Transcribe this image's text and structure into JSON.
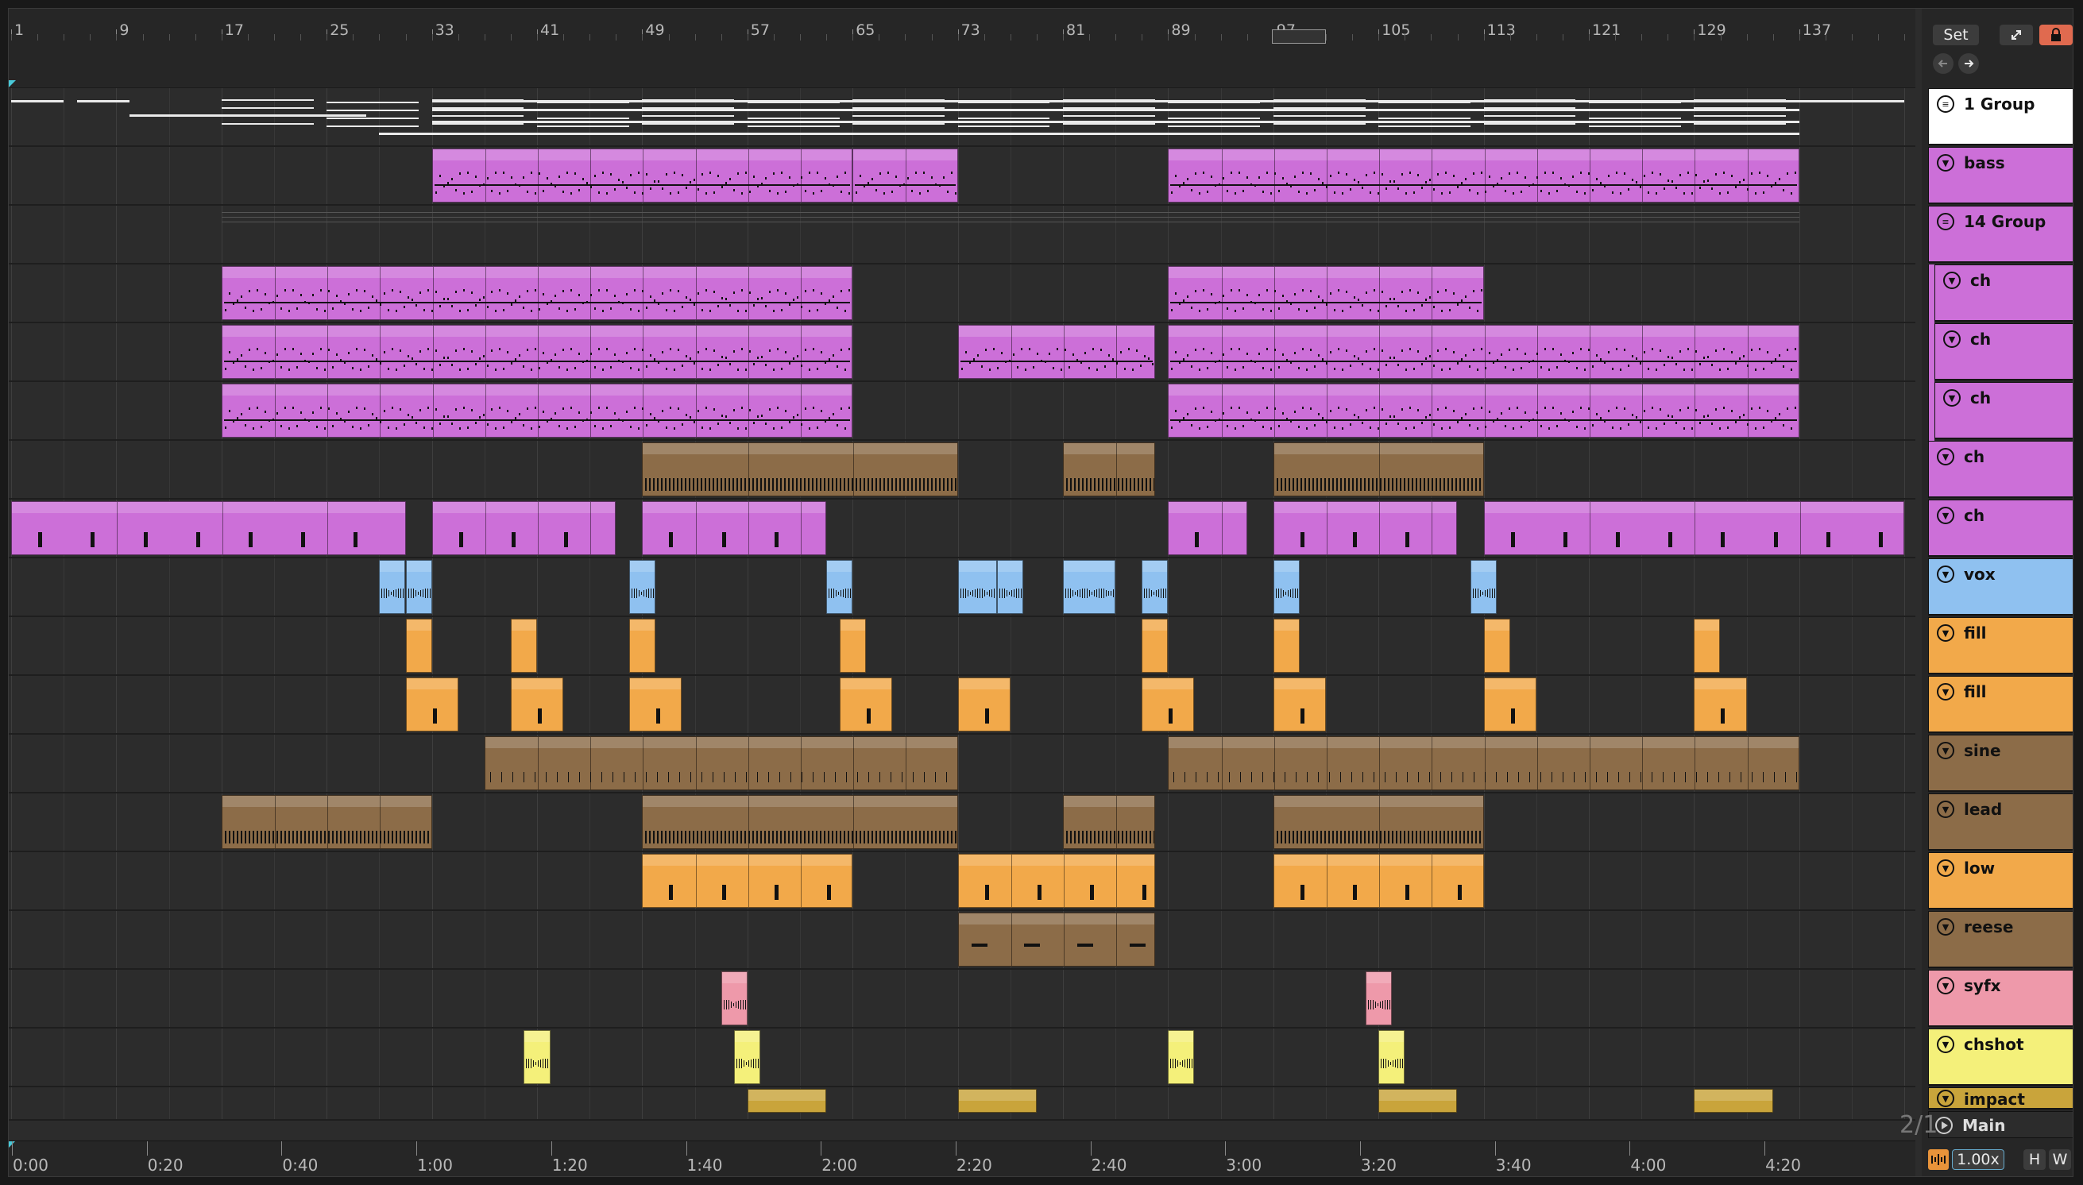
{
  "ruler": {
    "bars": [
      "1",
      "9",
      "17",
      "25",
      "33",
      "41",
      "49",
      "57",
      "65",
      "73",
      "81",
      "89",
      "97",
      "105",
      "113",
      "121",
      "129",
      "137"
    ]
  },
  "time_ruler": {
    "labels": [
      "0:00",
      "0:20",
      "0:40",
      "1:00",
      "1:20",
      "1:40",
      "2:00",
      "2:20",
      "2:40",
      "3:00",
      "3:20",
      "3:40",
      "4:00",
      "4:20"
    ]
  },
  "controls": {
    "set_label": "Set",
    "time_signature": "2/1",
    "zoom": "1.00x",
    "h_label": "H",
    "w_label": "W"
  },
  "colors": {
    "purple": "#cc6fd8",
    "brown": "#8c6c48",
    "blue": "#8fc1f0",
    "orange": "#f2a94a",
    "pink": "#ee99aa",
    "yellow": "#f4f07a",
    "gold": "#c9a43b",
    "white": "#ffffff"
  },
  "tracks": [
    {
      "name": "1 Group",
      "color": "white",
      "kind": "group"
    },
    {
      "name": "bass",
      "color": "purple",
      "kind": "track"
    },
    {
      "name": "14 Group",
      "color": "purple",
      "kind": "group"
    },
    {
      "name": "ch",
      "color": "purple",
      "kind": "child"
    },
    {
      "name": "ch",
      "color": "purple",
      "kind": "child"
    },
    {
      "name": "ch",
      "color": "purple",
      "kind": "child"
    },
    {
      "name": "ch",
      "color": "purple",
      "kind": "track"
    },
    {
      "name": "ch",
      "color": "purple",
      "kind": "track"
    },
    {
      "name": "vox",
      "color": "blue",
      "kind": "track"
    },
    {
      "name": "fill",
      "color": "orange",
      "kind": "track"
    },
    {
      "name": "fill",
      "color": "orange",
      "kind": "track"
    },
    {
      "name": "sine",
      "color": "brown",
      "kind": "track"
    },
    {
      "name": "lead",
      "color": "brown",
      "kind": "track"
    },
    {
      "name": "low",
      "color": "orange",
      "kind": "track"
    },
    {
      "name": "reese",
      "color": "brown",
      "kind": "track"
    },
    {
      "name": "syfx",
      "color": "pink",
      "kind": "track"
    },
    {
      "name": "chshot",
      "color": "yellow",
      "kind": "track"
    },
    {
      "name": "impact",
      "color": "gold",
      "kind": "track"
    }
  ],
  "main_track": {
    "name": "Main"
  }
}
